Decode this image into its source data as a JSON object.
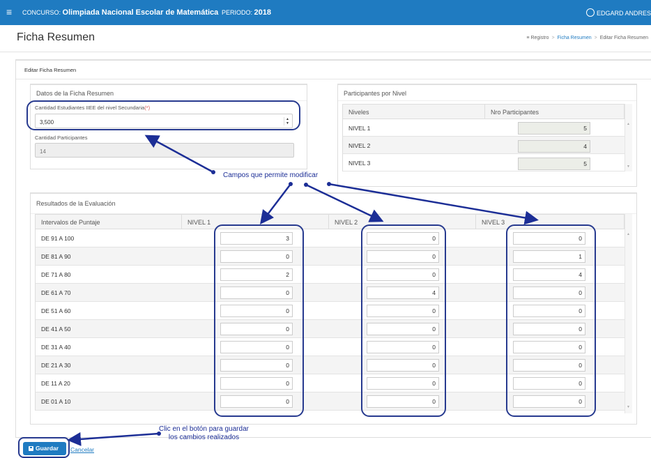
{
  "topbar": {
    "contest_label": "CONCURSO:",
    "contest_name": "Olimpiada Nacional Escolar de Matemática",
    "period_label": "PERIODO:",
    "period_value": "2018",
    "user_name": "EDGARD ANDRES"
  },
  "page": {
    "title": "Ficha Resumen",
    "breadcrumb": [
      "Registro",
      "Ficha Resumen",
      "Editar Ficha Resumen"
    ],
    "section_title": "Editar Ficha Resumen"
  },
  "datos": {
    "title": "Datos de la Ficha Resumen",
    "field1_label": "Cantidad Estudiantes IIEE del nivel Secundaria",
    "field1_required": "(*)",
    "field1_value": "3,500",
    "field2_label": "Cantidad Participantes",
    "field2_value": "14"
  },
  "participantes": {
    "title": "Participantes por Nivel",
    "headers": [
      "Niveles",
      "Nro Participantes"
    ],
    "rows": [
      {
        "nivel": "NIVEL 1",
        "value": "5"
      },
      {
        "nivel": "NIVEL 2",
        "value": "4"
      },
      {
        "nivel": "NIVEL 3",
        "value": "5"
      }
    ]
  },
  "resultados": {
    "title": "Resultados de la Evaluación",
    "headers": [
      "Intervalos de Puntaje",
      "NIVEL 1",
      "NIVEL 2",
      "NIVEL 3"
    ],
    "rows": [
      {
        "intervalo": "DE 91 A 100",
        "n1": "3",
        "n2": "0",
        "n3": "0"
      },
      {
        "intervalo": "DE 81 A 90",
        "n1": "0",
        "n2": "0",
        "n3": "1"
      },
      {
        "intervalo": "DE 71 A 80",
        "n1": "2",
        "n2": "0",
        "n3": "4"
      },
      {
        "intervalo": "DE 61 A 70",
        "n1": "0",
        "n2": "4",
        "n3": "0"
      },
      {
        "intervalo": "DE 51 A 60",
        "n1": "0",
        "n2": "0",
        "n3": "0"
      },
      {
        "intervalo": "DE 41 A 50",
        "n1": "0",
        "n2": "0",
        "n3": "0"
      },
      {
        "intervalo": "DE 31 A 40",
        "n1": "0",
        "n2": "0",
        "n3": "0"
      },
      {
        "intervalo": "DE 21 A 30",
        "n1": "0",
        "n2": "0",
        "n3": "0"
      },
      {
        "intervalo": "DE 11 A 20",
        "n1": "0",
        "n2": "0",
        "n3": "0"
      },
      {
        "intervalo": "DE 01 A 10",
        "n1": "0",
        "n2": "0",
        "n3": "0"
      }
    ]
  },
  "annotations": {
    "fields": "Campos que permite modificar",
    "save_line1": "Clic en el botón para guardar",
    "save_line2": "los cambios realizados",
    "color": "#1c2e96"
  },
  "actions": {
    "save_label": "Guardar",
    "cancel_label": "Cancelar"
  },
  "colors": {
    "primary": "#1f7bc1",
    "required": "#d9534f"
  }
}
